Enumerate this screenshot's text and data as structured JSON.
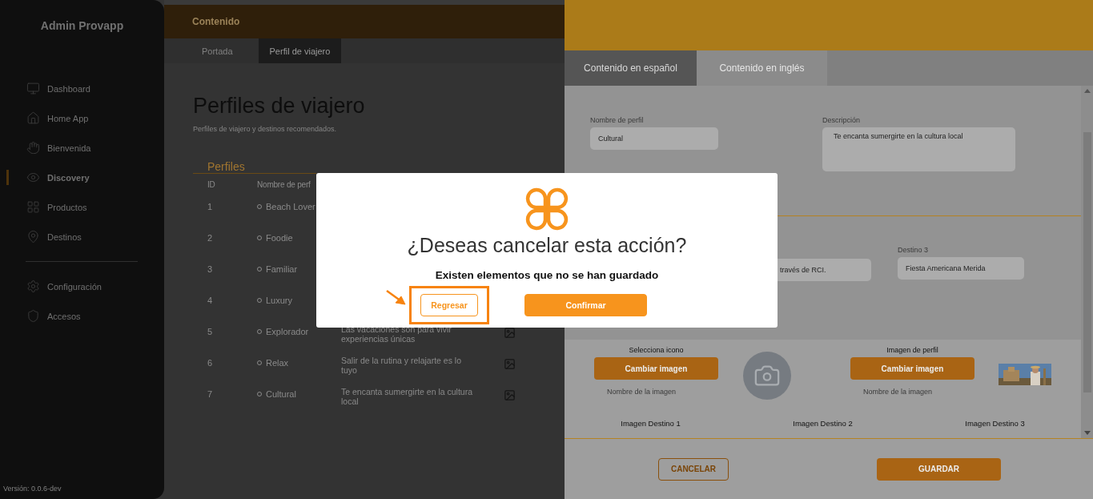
{
  "sidebar": {
    "brand": "Admin Provapp",
    "items": [
      {
        "label": "Dashboard",
        "kind": "monitor",
        "selected": false
      },
      {
        "label": "Home App",
        "kind": "home",
        "selected": false
      },
      {
        "label": "Bienvenida",
        "kind": "hand",
        "selected": false
      },
      {
        "label": "Discovery",
        "kind": "eye",
        "selected": true
      },
      {
        "label": "Productos",
        "kind": "grid",
        "selected": false
      },
      {
        "label": "Destinos",
        "kind": "pin",
        "selected": false
      }
    ],
    "settings_items": [
      {
        "label": "Configuración",
        "kind": "gear",
        "selected": false
      },
      {
        "label": "Accesos",
        "kind": "shield",
        "selected": false
      }
    ],
    "version": "Versión: 0.0.6-dev"
  },
  "header": {
    "title": "Contenido"
  },
  "subtabs": [
    {
      "label": "Portada",
      "selected": false
    },
    {
      "label": "Perfil de viajero",
      "selected": true
    }
  ],
  "page": {
    "title": "Perfiles de viajero",
    "subtitle": "Perfiles de viajero y destinos recomendados.",
    "section": "Perfiles",
    "columns": [
      "ID",
      "Nombre de perf"
    ],
    "rows": [
      {
        "id": "1",
        "name": "Beach Lover"
      },
      {
        "id": "2",
        "name": "Foodie"
      },
      {
        "id": "3",
        "name": "Familiar"
      },
      {
        "id": "4",
        "name": "Luxury"
      },
      {
        "id": "5",
        "name": "Explorador",
        "description": "Las vacaciones son para vivir experiencias únicas"
      },
      {
        "id": "6",
        "name": "Relax",
        "description": "Salir de la rutina y relajarte es lo tuyo"
      },
      {
        "id": "7",
        "name": "Cultural",
        "description": "Te encanta sumergirte en la cultura local"
      }
    ]
  },
  "editor": {
    "tabs": [
      {
        "label": "Contenido en español",
        "selected": true
      },
      {
        "label": "Contenido en inglés",
        "selected": false
      }
    ],
    "fields": [
      {
        "label": "Nombre de perfil",
        "value": "Cultural",
        "kind": "input"
      },
      {
        "label": "Descripción",
        "value": "Te encanta sumergirte en la cultura local",
        "kind": "textarea"
      }
    ],
    "destinations": [
      {
        "value": "través de RCI."
      },
      {
        "label": "Destino 3",
        "value": "Fiesta Americana Merida"
      }
    ],
    "uploads": [
      {
        "label": "Selecciona icono",
        "button": "Cambiar imagen",
        "filename": "Nombre de la imagen",
        "kind": "icon"
      },
      {
        "label": "Imagen de perfil",
        "button": "Cambiar imagen",
        "filename": "Nombre de la imagen",
        "kind": "picture"
      }
    ],
    "destination_images": [
      "Imagen Destino 1",
      "Imagen Destino 2",
      "Imagen Destino 3"
    ],
    "cancel": "CANCELAR",
    "save": "GUARDAR"
  },
  "dialog": {
    "title": "¿Deseas cancelar esta acción?",
    "message": "Existen elementos que no se han guardado",
    "buttons": [
      {
        "label": "Regresar",
        "kind": "outline",
        "highlighted": true
      },
      {
        "label": "Confirmar",
        "kind": "filled",
        "highlighted": false
      }
    ]
  }
}
